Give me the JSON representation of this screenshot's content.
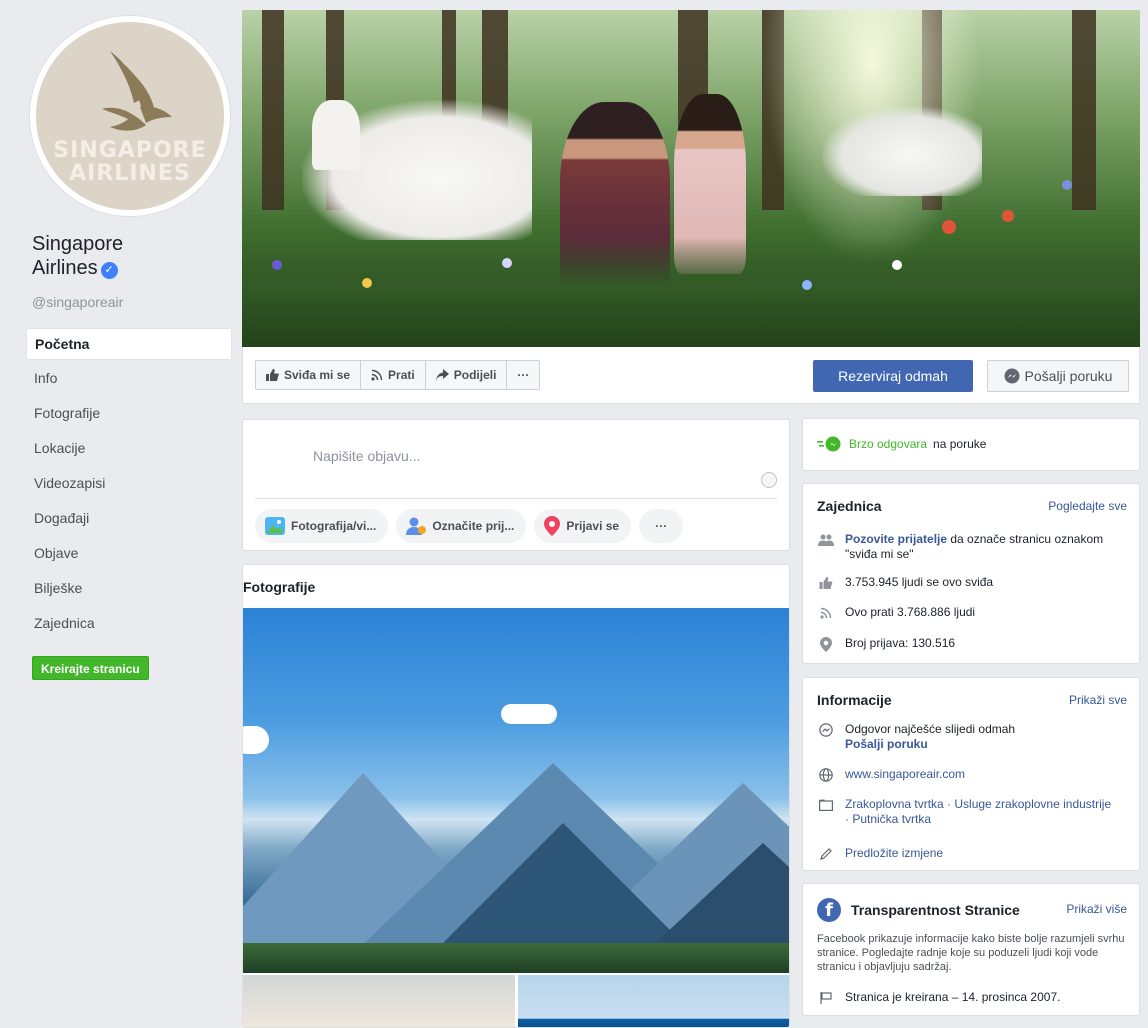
{
  "page": {
    "name": "Singapore Airlines",
    "name_line1": "Singapore",
    "name_line2": "Airlines",
    "handle": "@singaporeair",
    "logo_line1": "SINGAPORE",
    "logo_line2": "AIRLINES"
  },
  "nav": {
    "items": [
      {
        "label": "Početna",
        "active": true
      },
      {
        "label": "Info"
      },
      {
        "label": "Fotografije"
      },
      {
        "label": "Lokacije"
      },
      {
        "label": "Videozapisi"
      },
      {
        "label": "Događaji"
      },
      {
        "label": "Objave"
      },
      {
        "label": "Bilješke"
      },
      {
        "label": "Zajednica"
      }
    ],
    "create_page": "Kreirajte stranicu"
  },
  "actions": {
    "like": "Sviđa mi se",
    "follow": "Prati",
    "share": "Podijeli",
    "more": "···",
    "reserve": "Rezerviraj odmah",
    "message": "Pošalji poruku"
  },
  "composer": {
    "placeholder": "Napišite objavu...",
    "photo": "Fotografija/vi...",
    "tag": "Označite prij...",
    "checkin": "Prijavi se",
    "more": "···"
  },
  "photos": {
    "title": "Fotografije"
  },
  "quick_reply": {
    "highlight": "Brzo odgovara",
    "rest": "na poruke"
  },
  "community": {
    "title": "Zajednica",
    "see_all": "Pogledajte sve",
    "invite_link": "Pozovite prijatelje",
    "invite_rest": "da označe stranicu oznakom \"sviđa mi se\"",
    "likes": "3.753.945 ljudi se ovo sviđa",
    "follows": "Ovo prati 3.768.886 ljudi",
    "checkins": "Broj prijava: 130.516"
  },
  "info": {
    "title": "Informacije",
    "show_all": "Prikaži sve",
    "response": "Odgovor najčešće slijedi odmah",
    "send_message": "Pošalji poruku",
    "website": "www.singaporeair.com",
    "category": "Zrakoplovna tvrtka · Usluge zrakoplovne industrije · Putnička tvrtka",
    "suggest": "Predložite izmjene"
  },
  "transparency": {
    "title": "Transparentnost Stranice",
    "show_more": "Prikaži više",
    "body": "Facebook prikazuje informacije kako biste bolje razumjeli svrhu stranice. Pogledajte radnje koje su poduzeli ljudi koji vode stranicu i objavljuju sadržaj.",
    "created": "Stranica je kreirana – 14. prosinca 2007."
  },
  "colors": {
    "brand_blue": "#4267b2",
    "link_blue": "#385898",
    "green": "#42b72a",
    "verified": "#4080ff"
  }
}
